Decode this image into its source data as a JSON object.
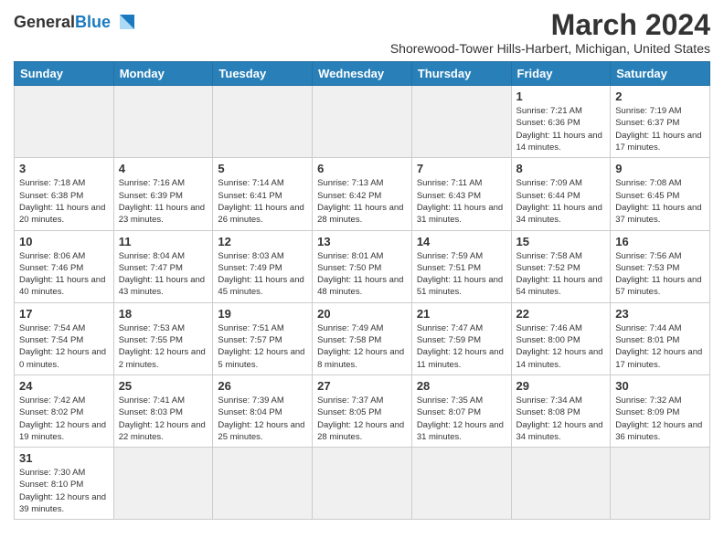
{
  "header": {
    "logo_general": "General",
    "logo_blue": "Blue",
    "month_title": "March 2024",
    "subtitle": "Shorewood-Tower Hills-Harbert, Michigan, United States"
  },
  "weekdays": [
    "Sunday",
    "Monday",
    "Tuesday",
    "Wednesday",
    "Thursday",
    "Friday",
    "Saturday"
  ],
  "weeks": [
    [
      {
        "day": "",
        "info": ""
      },
      {
        "day": "",
        "info": ""
      },
      {
        "day": "",
        "info": ""
      },
      {
        "day": "",
        "info": ""
      },
      {
        "day": "",
        "info": ""
      },
      {
        "day": "1",
        "info": "Sunrise: 7:21 AM\nSunset: 6:36 PM\nDaylight: 11 hours and 14 minutes."
      },
      {
        "day": "2",
        "info": "Sunrise: 7:19 AM\nSunset: 6:37 PM\nDaylight: 11 hours and 17 minutes."
      }
    ],
    [
      {
        "day": "3",
        "info": "Sunrise: 7:18 AM\nSunset: 6:38 PM\nDaylight: 11 hours and 20 minutes."
      },
      {
        "day": "4",
        "info": "Sunrise: 7:16 AM\nSunset: 6:39 PM\nDaylight: 11 hours and 23 minutes."
      },
      {
        "day": "5",
        "info": "Sunrise: 7:14 AM\nSunset: 6:41 PM\nDaylight: 11 hours and 26 minutes."
      },
      {
        "day": "6",
        "info": "Sunrise: 7:13 AM\nSunset: 6:42 PM\nDaylight: 11 hours and 28 minutes."
      },
      {
        "day": "7",
        "info": "Sunrise: 7:11 AM\nSunset: 6:43 PM\nDaylight: 11 hours and 31 minutes."
      },
      {
        "day": "8",
        "info": "Sunrise: 7:09 AM\nSunset: 6:44 PM\nDaylight: 11 hours and 34 minutes."
      },
      {
        "day": "9",
        "info": "Sunrise: 7:08 AM\nSunset: 6:45 PM\nDaylight: 11 hours and 37 minutes."
      }
    ],
    [
      {
        "day": "10",
        "info": "Sunrise: 8:06 AM\nSunset: 7:46 PM\nDaylight: 11 hours and 40 minutes."
      },
      {
        "day": "11",
        "info": "Sunrise: 8:04 AM\nSunset: 7:47 PM\nDaylight: 11 hours and 43 minutes."
      },
      {
        "day": "12",
        "info": "Sunrise: 8:03 AM\nSunset: 7:49 PM\nDaylight: 11 hours and 45 minutes."
      },
      {
        "day": "13",
        "info": "Sunrise: 8:01 AM\nSunset: 7:50 PM\nDaylight: 11 hours and 48 minutes."
      },
      {
        "day": "14",
        "info": "Sunrise: 7:59 AM\nSunset: 7:51 PM\nDaylight: 11 hours and 51 minutes."
      },
      {
        "day": "15",
        "info": "Sunrise: 7:58 AM\nSunset: 7:52 PM\nDaylight: 11 hours and 54 minutes."
      },
      {
        "day": "16",
        "info": "Sunrise: 7:56 AM\nSunset: 7:53 PM\nDaylight: 11 hours and 57 minutes."
      }
    ],
    [
      {
        "day": "17",
        "info": "Sunrise: 7:54 AM\nSunset: 7:54 PM\nDaylight: 12 hours and 0 minutes."
      },
      {
        "day": "18",
        "info": "Sunrise: 7:53 AM\nSunset: 7:55 PM\nDaylight: 12 hours and 2 minutes."
      },
      {
        "day": "19",
        "info": "Sunrise: 7:51 AM\nSunset: 7:57 PM\nDaylight: 12 hours and 5 minutes."
      },
      {
        "day": "20",
        "info": "Sunrise: 7:49 AM\nSunset: 7:58 PM\nDaylight: 12 hours and 8 minutes."
      },
      {
        "day": "21",
        "info": "Sunrise: 7:47 AM\nSunset: 7:59 PM\nDaylight: 12 hours and 11 minutes."
      },
      {
        "day": "22",
        "info": "Sunrise: 7:46 AM\nSunset: 8:00 PM\nDaylight: 12 hours and 14 minutes."
      },
      {
        "day": "23",
        "info": "Sunrise: 7:44 AM\nSunset: 8:01 PM\nDaylight: 12 hours and 17 minutes."
      }
    ],
    [
      {
        "day": "24",
        "info": "Sunrise: 7:42 AM\nSunset: 8:02 PM\nDaylight: 12 hours and 19 minutes."
      },
      {
        "day": "25",
        "info": "Sunrise: 7:41 AM\nSunset: 8:03 PM\nDaylight: 12 hours and 22 minutes."
      },
      {
        "day": "26",
        "info": "Sunrise: 7:39 AM\nSunset: 8:04 PM\nDaylight: 12 hours and 25 minutes."
      },
      {
        "day": "27",
        "info": "Sunrise: 7:37 AM\nSunset: 8:05 PM\nDaylight: 12 hours and 28 minutes."
      },
      {
        "day": "28",
        "info": "Sunrise: 7:35 AM\nSunset: 8:07 PM\nDaylight: 12 hours and 31 minutes."
      },
      {
        "day": "29",
        "info": "Sunrise: 7:34 AM\nSunset: 8:08 PM\nDaylight: 12 hours and 34 minutes."
      },
      {
        "day": "30",
        "info": "Sunrise: 7:32 AM\nSunset: 8:09 PM\nDaylight: 12 hours and 36 minutes."
      }
    ],
    [
      {
        "day": "31",
        "info": "Sunrise: 7:30 AM\nSunset: 8:10 PM\nDaylight: 12 hours and 39 minutes."
      },
      {
        "day": "",
        "info": ""
      },
      {
        "day": "",
        "info": ""
      },
      {
        "day": "",
        "info": ""
      },
      {
        "day": "",
        "info": ""
      },
      {
        "day": "",
        "info": ""
      },
      {
        "day": "",
        "info": ""
      }
    ]
  ]
}
